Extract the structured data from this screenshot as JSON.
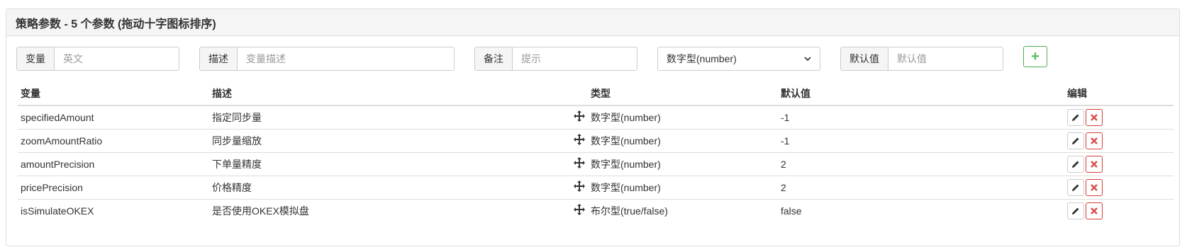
{
  "panel": {
    "title": "策略参数 - 5 个参数 (拖动十字图标排序)"
  },
  "form": {
    "variable": {
      "label": "变量",
      "placeholder": "英文"
    },
    "description": {
      "label": "描述",
      "placeholder": "变量描述"
    },
    "remark": {
      "label": "备注",
      "placeholder": "提示"
    },
    "type_select": {
      "value": "数字型(number)"
    },
    "default": {
      "label": "默认值",
      "placeholder": "默认值"
    },
    "add_icon": "plus-icon",
    "add_label": "+"
  },
  "table": {
    "headers": {
      "variable": "变量",
      "description": "描述",
      "type": "类型",
      "default": "默认值",
      "edit": "编辑"
    },
    "rows": [
      {
        "variable": "specifiedAmount",
        "description": "指定同步量",
        "type": "数字型(number)",
        "default": "-1"
      },
      {
        "variable": "zoomAmountRatio",
        "description": "同步量缩放",
        "type": "数字型(number)",
        "default": "-1"
      },
      {
        "variable": "amountPrecision",
        "description": "下单量精度",
        "type": "数字型(number)",
        "default": "2"
      },
      {
        "variable": "pricePrecision",
        "description": "价格精度",
        "type": "数字型(number)",
        "default": "2"
      },
      {
        "variable": "isSimulateOKEX",
        "description": "是否使用OKEX模拟盘",
        "type": "布尔型(true/false)",
        "default": "false"
      }
    ]
  },
  "colors": {
    "add_button": "#5cb85c",
    "delete_button": "#d9534f",
    "border": "#dddddd",
    "heading_bg": "#f5f5f5"
  },
  "icons": {
    "drag": "move-icon",
    "edit": "pencil-icon",
    "delete": "close-icon"
  }
}
